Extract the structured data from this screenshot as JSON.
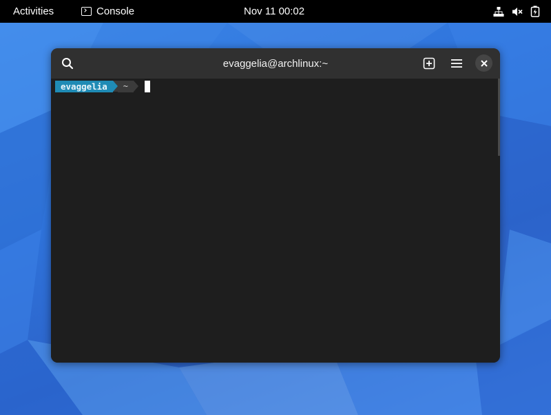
{
  "topbar": {
    "activities_label": "Activities",
    "app_name": "Console",
    "app_icon": "console-icon",
    "clock": "Nov 11  00:02",
    "tray_icons": [
      "network-wired-icon",
      "volume-muted-icon",
      "battery-charging-icon"
    ]
  },
  "window": {
    "title": "evaggelia@archlinux:~",
    "buttons": [
      "search-icon",
      "new-tab-icon",
      "hamburger-menu-icon",
      "close-icon"
    ]
  },
  "terminal": {
    "prompt_user": "evaggelia",
    "prompt_dir": "~",
    "accent_color": "#1f8bb5",
    "background_color": "#1e1e1e"
  }
}
